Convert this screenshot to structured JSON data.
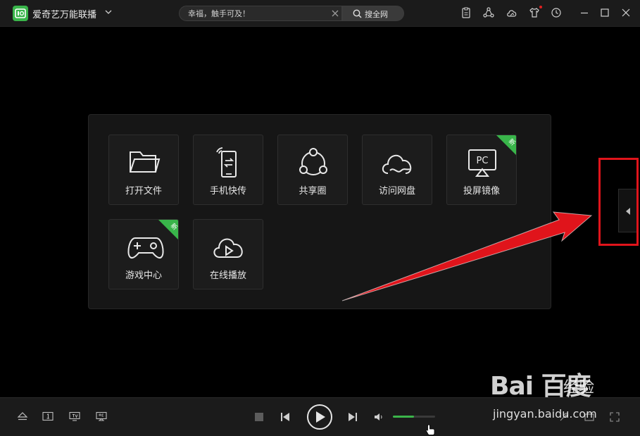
{
  "app": {
    "title": "爱奇艺万能联播",
    "accent_color": "#39b54a"
  },
  "search": {
    "placeholder": "幸福，触手可及！",
    "button_label": "搜全网"
  },
  "toolbar_icons": [
    "clipboard-icon",
    "share-network-icon",
    "cloud-upload-icon",
    "tshirt-skin-icon",
    "history-clock-icon"
  ],
  "window_controls": [
    "minimize-icon",
    "maximize-icon",
    "close-icon"
  ],
  "tiles": [
    {
      "label": "打开文件",
      "icon": "folder-icon",
      "is_new": false
    },
    {
      "label": "手机快传",
      "icon": "phone-transfer-icon",
      "is_new": false
    },
    {
      "label": "共享圈",
      "icon": "share-circle-icon",
      "is_new": false
    },
    {
      "label": "访问网盘",
      "icon": "cloud-drive-icon",
      "is_new": false
    },
    {
      "label": "投屏镜像",
      "icon": "screen-mirror-icon",
      "is_new": true
    },
    {
      "label": "游戏中心",
      "icon": "gamepad-icon",
      "is_new": true
    },
    {
      "label": "在线播放",
      "icon": "cloud-play-icon",
      "is_new": false
    }
  ],
  "new_badge_text": "新",
  "screen_mirror_icon_text": "PC",
  "annotation": {
    "highlight_color": "#e0141b"
  },
  "controls": {
    "volume_level": 0.5
  },
  "watermark": {
    "logo": "Bai 百度",
    "brand_cn": "经验",
    "url": "jingyan.baidu.com"
  }
}
